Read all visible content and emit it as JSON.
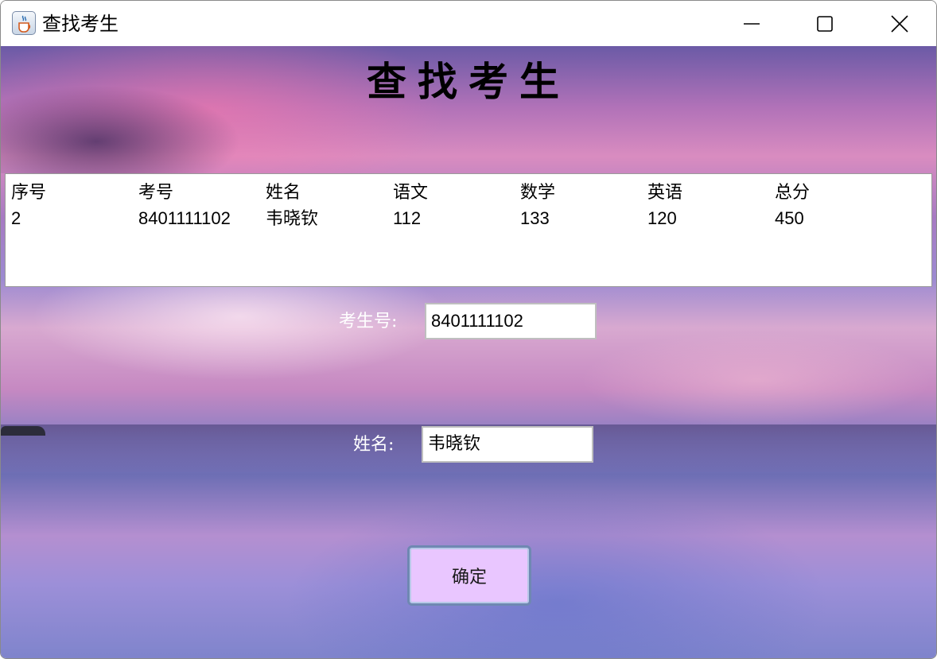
{
  "window": {
    "title": "查找考生",
    "app_icon": "java-cup-icon",
    "controls": {
      "minimize_icon": "minimize-icon",
      "maximize_icon": "maximize-icon",
      "close_icon": "close-icon"
    }
  },
  "main": {
    "heading": "查找考生",
    "table": {
      "columns": [
        "序号",
        "考号",
        "姓名",
        "语文",
        "数学",
        "英语",
        "总分"
      ],
      "rows": [
        [
          "2",
          "8401111102",
          "韦晓钦",
          "112",
          "133",
          "120",
          "450"
        ]
      ]
    },
    "form": {
      "exam_id_label": "考生号:",
      "exam_id_value": "8401111102",
      "name_label": "姓名:",
      "name_value": "韦晓钦",
      "confirm_label": "确定"
    }
  },
  "colors": {
    "confirm_button_bg": "#e9c6ff",
    "confirm_button_border": "#6f88b2",
    "label_text": "#ffffff"
  }
}
